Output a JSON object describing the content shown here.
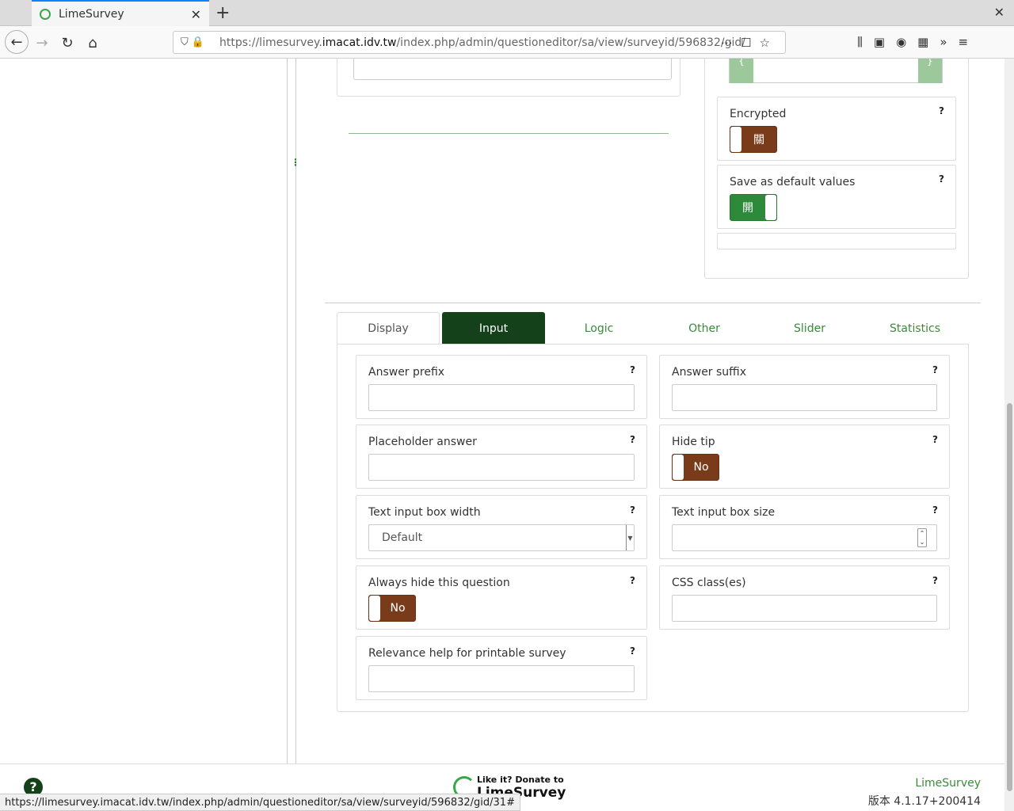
{
  "browser": {
    "tab_title": "LimeSurvey",
    "url_prefix": "https://limesurvey.",
    "url_host": "imacat.idv.tw",
    "url_path": "/index.php/admin/questioneditor/sa/view/surveyid/596832/gid/"
  },
  "right_panel": {
    "encrypted_label": "Encrypted",
    "encrypted_value": "關",
    "save_default_label": "Save as default values",
    "save_default_value": "開",
    "help": "?"
  },
  "tabs": [
    {
      "label": "Display"
    },
    {
      "label": "Input"
    },
    {
      "label": "Logic"
    },
    {
      "label": "Other"
    },
    {
      "label": "Slider"
    },
    {
      "label": "Statistics"
    }
  ],
  "fields": {
    "answer_prefix": "Answer prefix",
    "answer_suffix": "Answer suffix",
    "placeholder_answer": "Placeholder answer",
    "hide_tip": "Hide tip",
    "hide_tip_value": "No",
    "text_input_width": "Text input box width",
    "text_input_width_value": "Default",
    "text_input_size": "Text input box size",
    "always_hide": "Always hide this question",
    "always_hide_value": "No",
    "css_classes": "CSS class(es)",
    "relevance_help": "Relevance help for printable survey"
  },
  "footer": {
    "donate_line1": "Like it? Donate to",
    "donate_line2": "LimeSurvey",
    "brand": "LimeSurvey",
    "version": "版本 4.1.17+200414"
  },
  "status_url": "https://limesurvey.imacat.idv.tw/index.php/admin/questioneditor/sa/view/surveyid/596832/gid/31#"
}
